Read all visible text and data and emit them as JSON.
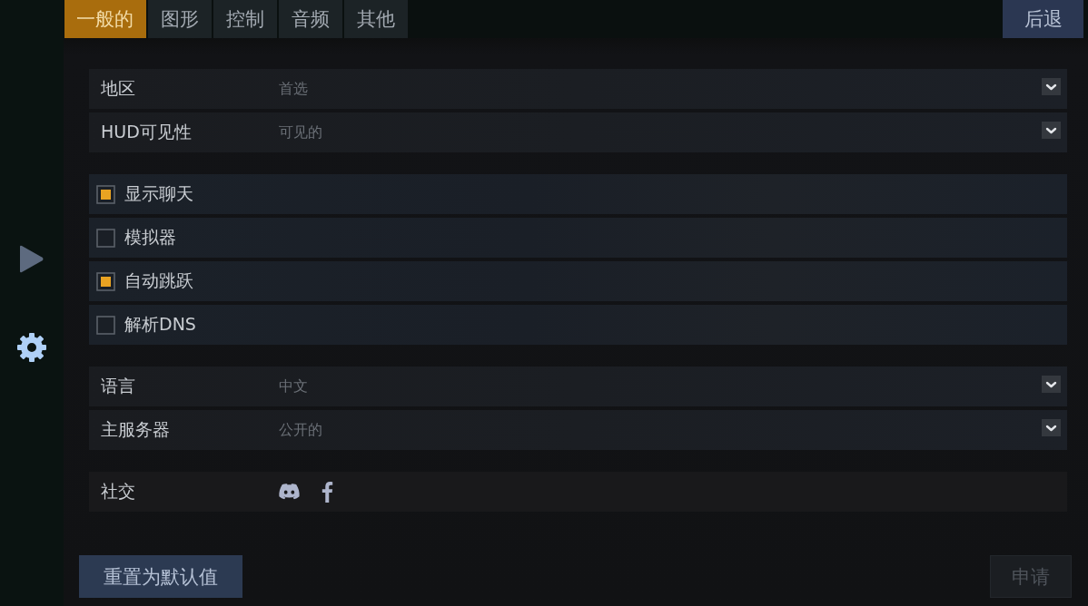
{
  "sidebar": {
    "items": [
      {
        "kind": "play",
        "selected": false
      },
      {
        "kind": "settings",
        "selected": true
      }
    ]
  },
  "tabs": [
    {
      "label": "一般的",
      "selected": true
    },
    {
      "label": "图形",
      "selected": false
    },
    {
      "label": "控制",
      "selected": false
    },
    {
      "label": "音频",
      "selected": false
    },
    {
      "label": "其他",
      "selected": false
    }
  ],
  "back_button": {
    "label": "后退"
  },
  "settings": {
    "groups": [
      {
        "rows": [
          {
            "kind": "dropdown",
            "label": "地区",
            "value": "首选"
          },
          {
            "kind": "dropdown",
            "label": "HUD可见性",
            "value": "可见的"
          }
        ]
      },
      {
        "rows": [
          {
            "kind": "checkbox",
            "label": "显示聊天",
            "checked": true
          },
          {
            "kind": "checkbox",
            "label": "模拟器",
            "checked": false
          },
          {
            "kind": "checkbox",
            "label": "自动跳跃",
            "checked": true
          },
          {
            "kind": "checkbox",
            "label": "解析DNS",
            "checked": false
          }
        ]
      },
      {
        "rows": [
          {
            "kind": "dropdown",
            "label": "语言",
            "value": "中文"
          },
          {
            "kind": "dropdown",
            "label": "主服务器",
            "value": "公开的"
          }
        ]
      },
      {
        "rows": [
          {
            "kind": "social",
            "label": "社交"
          }
        ]
      }
    ]
  },
  "footer": {
    "reset_button": {
      "label": "重置为默认值"
    },
    "apply_button": {
      "label": "申请",
      "disabled": true
    }
  }
}
